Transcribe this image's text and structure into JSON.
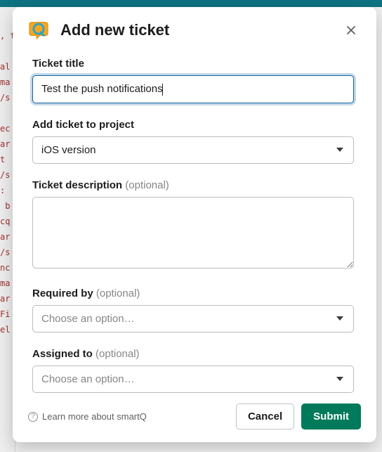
{
  "modal": {
    "title": "Add new ticket",
    "logo_name": "smartq-logo"
  },
  "fields": {
    "title": {
      "label": "Ticket title",
      "value": "Test the push notifications"
    },
    "project": {
      "label": "Add ticket to project",
      "selected": "iOS version"
    },
    "description": {
      "label": "Ticket description",
      "optional": "(optional)",
      "value": ""
    },
    "required_by": {
      "label": "Required by",
      "optional": "(optional)",
      "placeholder": "Choose an option…"
    },
    "assigned_to": {
      "label": "Assigned to",
      "optional": "(optional)",
      "placeholder": "Choose an option…"
    }
  },
  "footer": {
    "learn_more": "Learn more about smartQ",
    "cancel": "Cancel",
    "submit": "Submit"
  },
  "bg_code_lines": ", ta\n\nal\nma\n/s\n\nec\nar\nt\n/s\n:\n b\ncq\nar\n/s\nnc\nma\nar\nFi\nel"
}
